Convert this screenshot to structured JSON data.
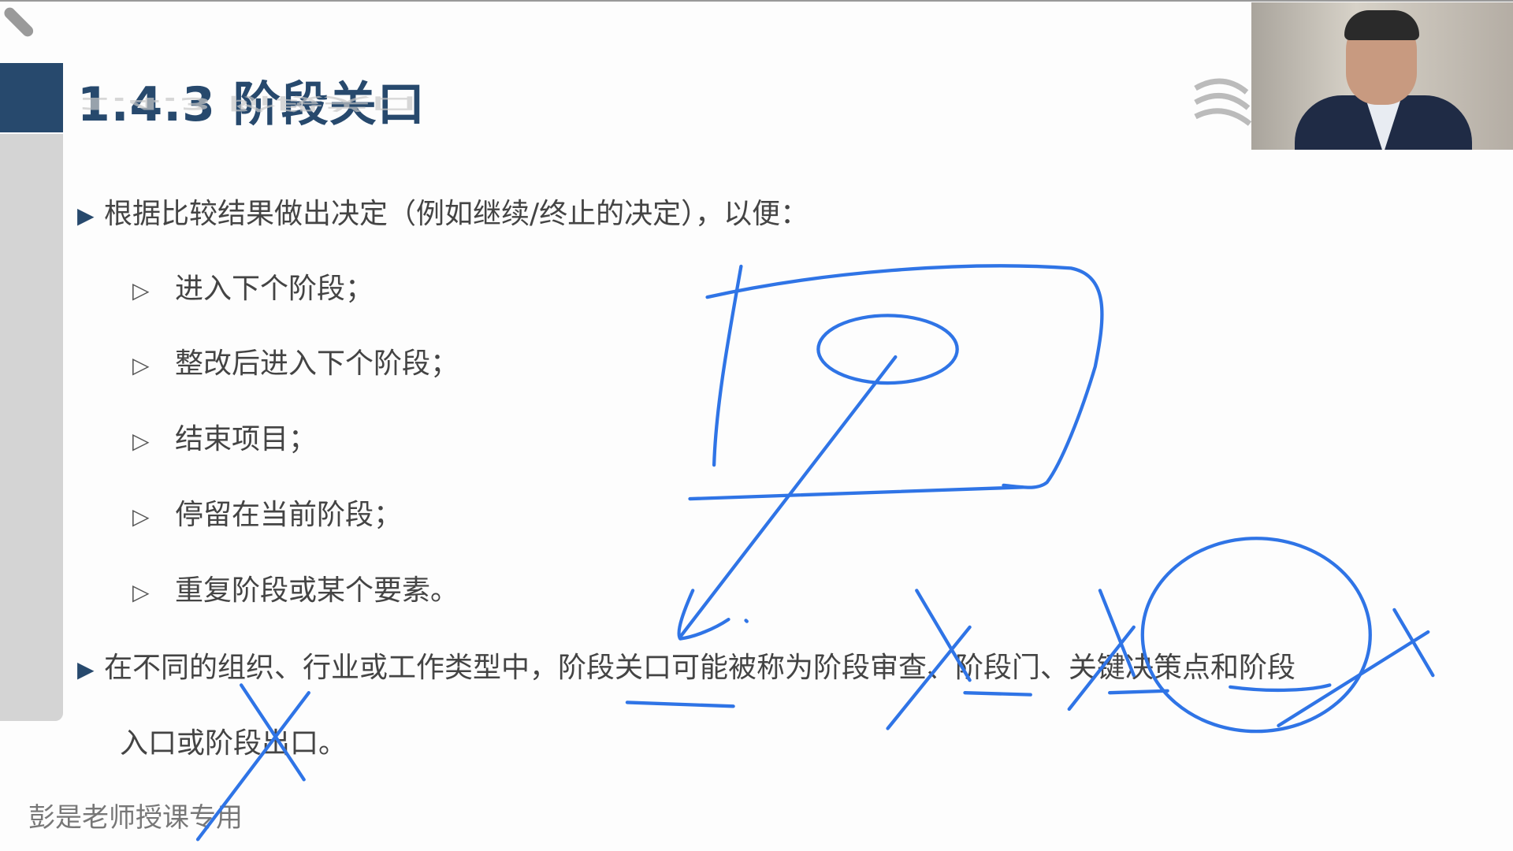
{
  "slide": {
    "title": "1.4.3 阶段关口",
    "bullets": [
      {
        "text": "根据比较结果做出决定（例如继续/终止的决定），以便："
      },
      {
        "text": "在不同的组织、行业或工作类型中，阶段关口可能被称为阶段审查、阶段门、关键决策点和阶段",
        "continuation": "入口或阶段出口。"
      }
    ],
    "sub_bullets": [
      "进入下个阶段；",
      "整改后进入下个阶段；",
      "结束项目；",
      "停留在当前阶段；",
      "重复阶段或某个要素。"
    ],
    "bullet_marker": "▶",
    "sub_marker": "▷",
    "footer": "彭是老师授课专用"
  },
  "colors": {
    "title": "#27496d",
    "ink": "#2f74e6",
    "text": "#444444"
  }
}
